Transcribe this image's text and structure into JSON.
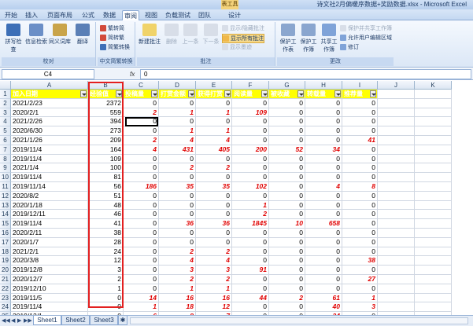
{
  "window": {
    "title": "诗文社2月偏暖序数据+奖励数据.xlsx - Microsoft Excel",
    "context_tab": "表工具"
  },
  "ribbon_tabs": [
    "开始",
    "插入",
    "页面布局",
    "公式",
    "数据",
    "审阅",
    "视图",
    "负载测试",
    "团队",
    "设计"
  ],
  "ribbon": {
    "proofing": {
      "label": "校对",
      "buttons": [
        "拼写检查",
        "信息检索",
        "同义词库",
        "翻译"
      ]
    },
    "chinese": {
      "label": "中文简繁转换",
      "items": [
        "繁转简",
        "简转繁",
        "简繁转换"
      ]
    },
    "comments": {
      "label": "批注",
      "buttons": [
        "新建批注",
        "删除",
        "上一条",
        "下一条"
      ],
      "items": [
        "显示/隐藏批注",
        "显示所有批注",
        "显示墨迹"
      ]
    },
    "changes": {
      "label": "更改",
      "buttons": [
        "保护工作表",
        "保护工作簿",
        "共享工作簿"
      ],
      "items": [
        "保护并共享工作簿",
        "允许用户编辑区域",
        "修订"
      ]
    }
  },
  "formula_bar": {
    "name_box": "C4",
    "fx": "fx",
    "value": "0"
  },
  "columns": [
    "A",
    "B",
    "C",
    "D",
    "E",
    "F",
    "G",
    "H",
    "I",
    "J",
    "K"
  ],
  "header_row": [
    "加入日期",
    "经验值",
    "投稿量",
    "打赏金额",
    "获得打赏",
    "阅读量",
    "被收藏",
    "转载量",
    "推荐量"
  ],
  "rows": [
    {
      "n": "2",
      "date": "2021/2/23",
      "b": "2372",
      "c": "0",
      "d": "0",
      "e": "0",
      "f": "0",
      "g": "0",
      "h": "0",
      "i": "0"
    },
    {
      "n": "3",
      "date": "2020/2/1",
      "b": "559",
      "c": "2",
      "d": "1",
      "e": "1",
      "f": "109",
      "g": "0",
      "h": "0",
      "i": "0"
    },
    {
      "n": "4",
      "date": "2021/2/26",
      "b": "394",
      "c": "0",
      "d": "0",
      "e": "0",
      "f": "0",
      "g": "0",
      "h": "0",
      "i": "0"
    },
    {
      "n": "5",
      "date": "2020/6/30",
      "b": "273",
      "c": "0",
      "d": "1",
      "e": "1",
      "f": "0",
      "g": "0",
      "h": "0",
      "i": "0"
    },
    {
      "n": "6",
      "date": "2021/1/26",
      "b": "209",
      "c": "2",
      "d": "4",
      "e": "4",
      "f": "0",
      "g": "0",
      "h": "0",
      "i": "41"
    },
    {
      "n": "7",
      "date": "2019/11/4",
      "b": "164",
      "c": "4",
      "d": "431",
      "e": "405",
      "f": "200",
      "g": "52",
      "h": "34",
      "i": "0"
    },
    {
      "n": "8",
      "date": "2019/11/4",
      "b": "109",
      "c": "0",
      "d": "0",
      "e": "0",
      "f": "0",
      "g": "0",
      "h": "0",
      "i": "0"
    },
    {
      "n": "9",
      "date": "2021/1/4",
      "b": "100",
      "c": "0",
      "d": "2",
      "e": "2",
      "f": "0",
      "g": "0",
      "h": "0",
      "i": "0"
    },
    {
      "n": "10",
      "date": "2019/11/4",
      "b": "81",
      "c": "0",
      "d": "0",
      "e": "0",
      "f": "0",
      "g": "0",
      "h": "0",
      "i": "0"
    },
    {
      "n": "11",
      "date": "2019/11/14",
      "b": "56",
      "c": "186",
      "d": "35",
      "e": "35",
      "f": "102",
      "g": "0",
      "h": "4",
      "i": "8"
    },
    {
      "n": "12",
      "date": "2020/8/2",
      "b": "51",
      "c": "0",
      "d": "0",
      "e": "0",
      "f": "0",
      "g": "0",
      "h": "0",
      "i": "0"
    },
    {
      "n": "13",
      "date": "2020/1/18",
      "b": "48",
      "c": "0",
      "d": "0",
      "e": "0",
      "f": "1",
      "g": "0",
      "h": "0",
      "i": "0"
    },
    {
      "n": "14",
      "date": "2019/12/11",
      "b": "46",
      "c": "0",
      "d": "0",
      "e": "0",
      "f": "2",
      "g": "0",
      "h": "0",
      "i": "0"
    },
    {
      "n": "15",
      "date": "2019/11/4",
      "b": "41",
      "c": "0",
      "d": "36",
      "e": "36",
      "f": "1845",
      "g": "10",
      "h": "658",
      "i": "0"
    },
    {
      "n": "16",
      "date": "2020/2/11",
      "b": "38",
      "c": "0",
      "d": "0",
      "e": "0",
      "f": "0",
      "g": "0",
      "h": "0",
      "i": "0"
    },
    {
      "n": "17",
      "date": "2020/1/7",
      "b": "28",
      "c": "0",
      "d": "0",
      "e": "0",
      "f": "0",
      "g": "0",
      "h": "0",
      "i": "0"
    },
    {
      "n": "18",
      "date": "2021/2/1",
      "b": "24",
      "c": "0",
      "d": "2",
      "e": "2",
      "f": "0",
      "g": "0",
      "h": "0",
      "i": "0"
    },
    {
      "n": "19",
      "date": "2020/3/8",
      "b": "12",
      "c": "0",
      "d": "4",
      "e": "4",
      "f": "0",
      "g": "0",
      "h": "0",
      "i": "38"
    },
    {
      "n": "20",
      "date": "2019/12/8",
      "b": "3",
      "c": "0",
      "d": "3",
      "e": "3",
      "f": "91",
      "g": "0",
      "h": "0",
      "i": "0"
    },
    {
      "n": "21",
      "date": "2020/12/7",
      "b": "2",
      "c": "0",
      "d": "2",
      "e": "2",
      "f": "0",
      "g": "0",
      "h": "0",
      "i": "27"
    },
    {
      "n": "22",
      "date": "2019/12/10",
      "b": "1",
      "c": "0",
      "d": "1",
      "e": "1",
      "f": "0",
      "g": "0",
      "h": "0",
      "i": "0"
    },
    {
      "n": "23",
      "date": "2019/11/5",
      "b": "0",
      "c": "14",
      "d": "16",
      "e": "16",
      "f": "44",
      "g": "2",
      "h": "61",
      "i": "1"
    },
    {
      "n": "24",
      "date": "2019/11/4",
      "b": "0",
      "c": "1",
      "d": "18",
      "e": "12",
      "f": "0",
      "g": "0",
      "h": "40",
      "i": "3"
    },
    {
      "n": "25",
      "date": "2019/12/1",
      "b": "0",
      "c": "6",
      "d": "8",
      "e": "7",
      "f": "0",
      "g": "0",
      "h": "24",
      "i": "0"
    },
    {
      "n": "26",
      "date": "2019/11/4",
      "b": "0",
      "c": "0",
      "d": "1",
      "e": "1",
      "f": "837",
      "g": "78",
      "h": "21",
      "i": "0"
    },
    {
      "n": "27",
      "date": "2020/11/20",
      "b": "0",
      "c": "0",
      "d": "0",
      "e": "0",
      "f": "0",
      "g": "0",
      "h": "12",
      "i": "0"
    }
  ],
  "sheets": [
    "Sheet1",
    "Sheet2",
    "Sheet3"
  ],
  "colors": {
    "header_fill": "#ffff00",
    "emphasis": "#e00000",
    "annotation_box": "#e32020"
  }
}
